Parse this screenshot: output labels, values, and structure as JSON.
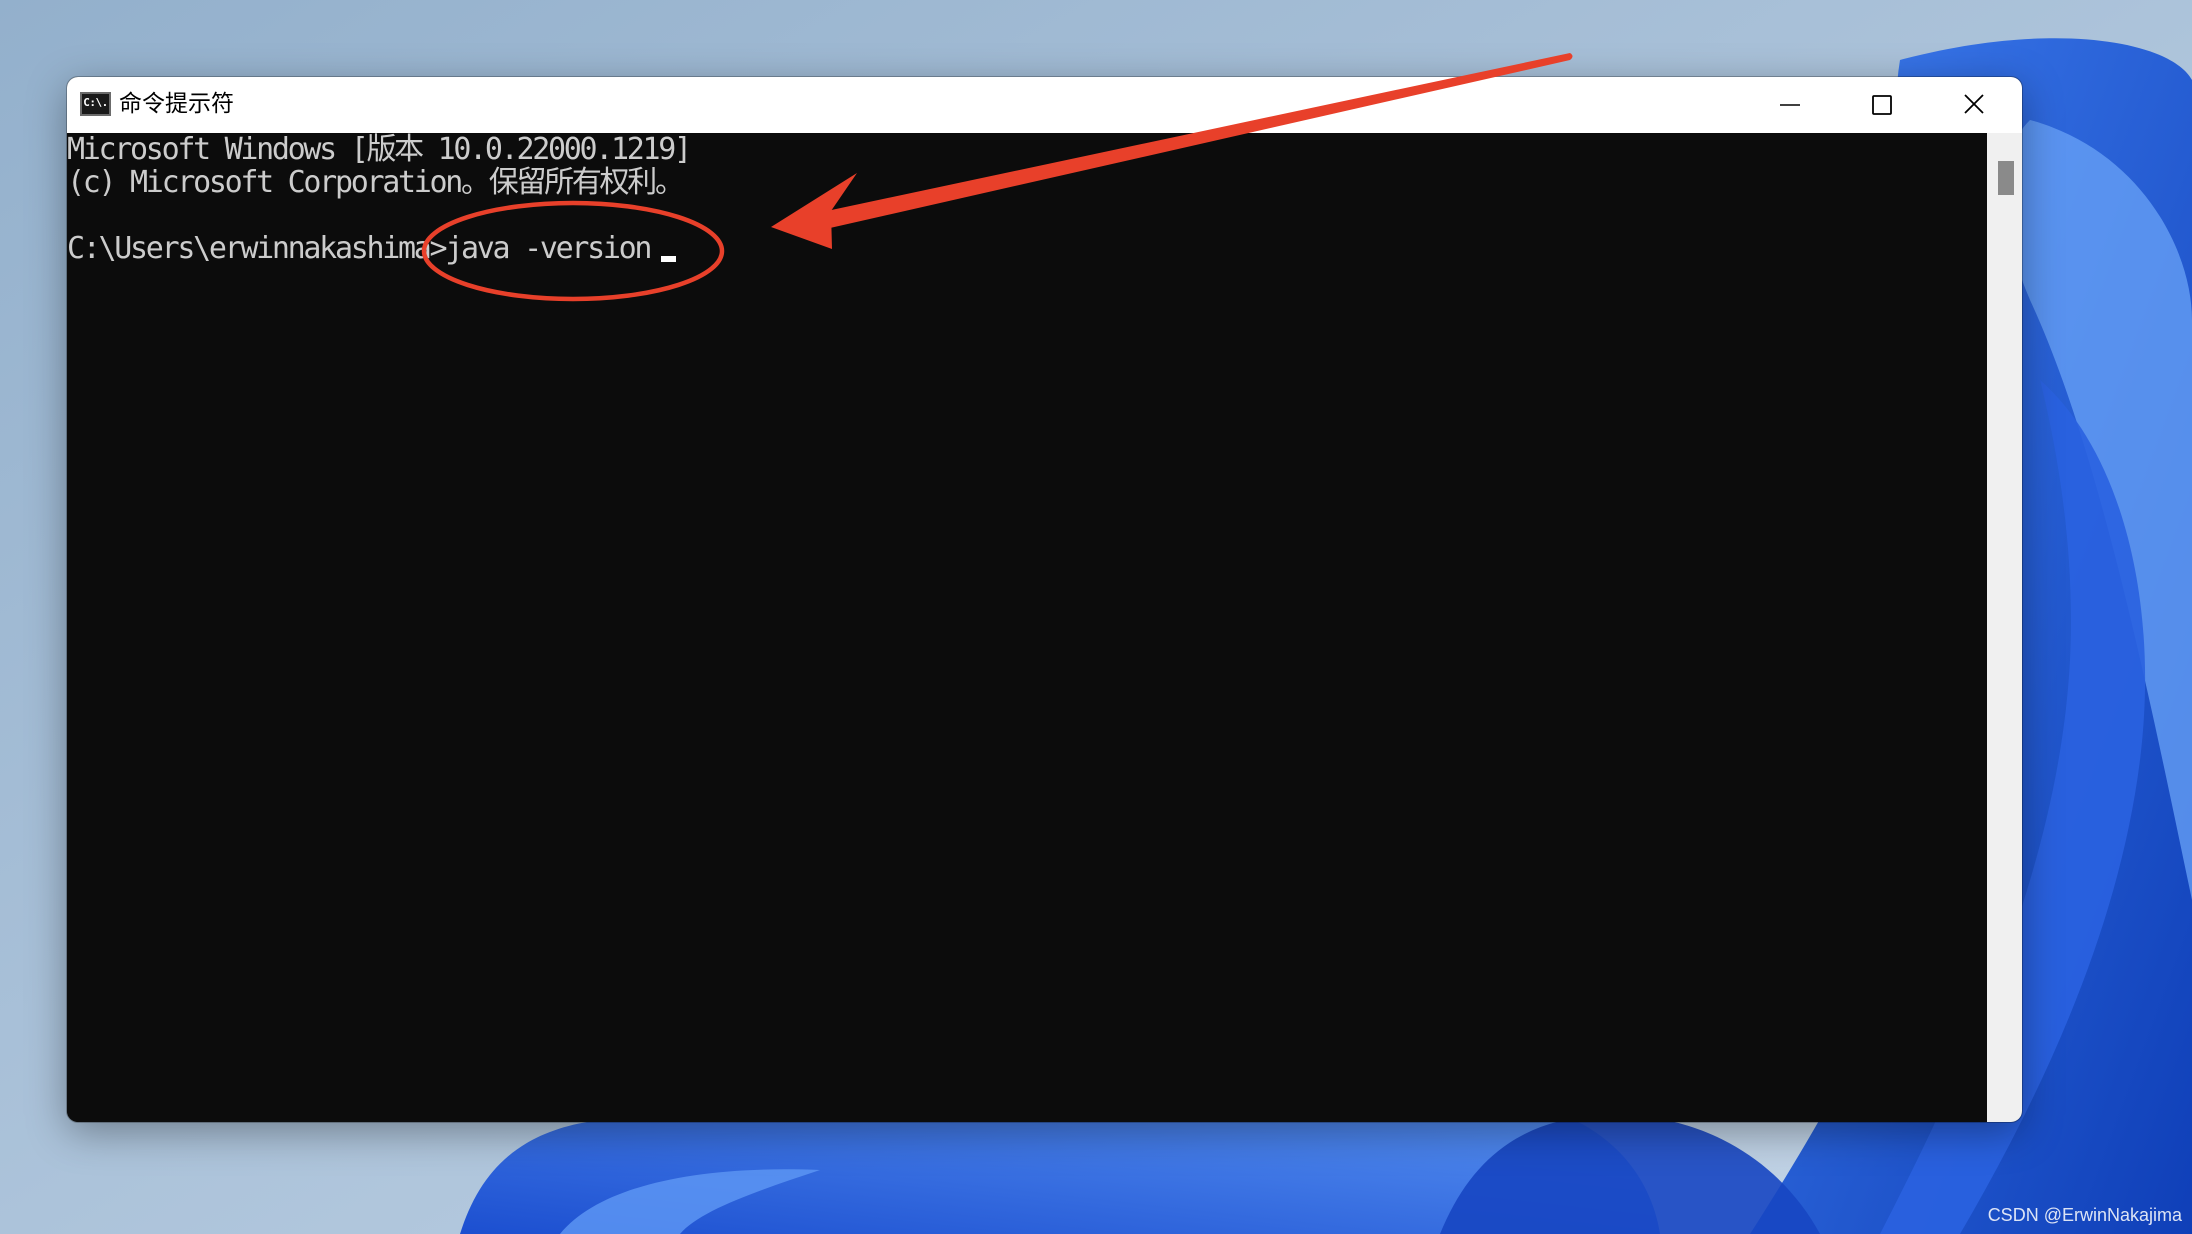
{
  "window": {
    "title": "命令提示符",
    "icon": "cmd-icon",
    "icon_text": "C:\\.",
    "controls": {
      "minimize": "minimize-icon",
      "maximize": "maximize-icon",
      "close": "close-icon"
    }
  },
  "console": {
    "lines": [
      "Microsoft Windows [版本 10.0.22000.1219]",
      "(c) Microsoft Corporation。保留所有权利。",
      "C:\\Users\\erwinnakashima>java -version"
    ],
    "background": "#0c0c0c",
    "foreground": "#cccccc"
  },
  "annotation": {
    "color": "#e8402a"
  },
  "watermark": "CSDN @ErwinNakajima"
}
